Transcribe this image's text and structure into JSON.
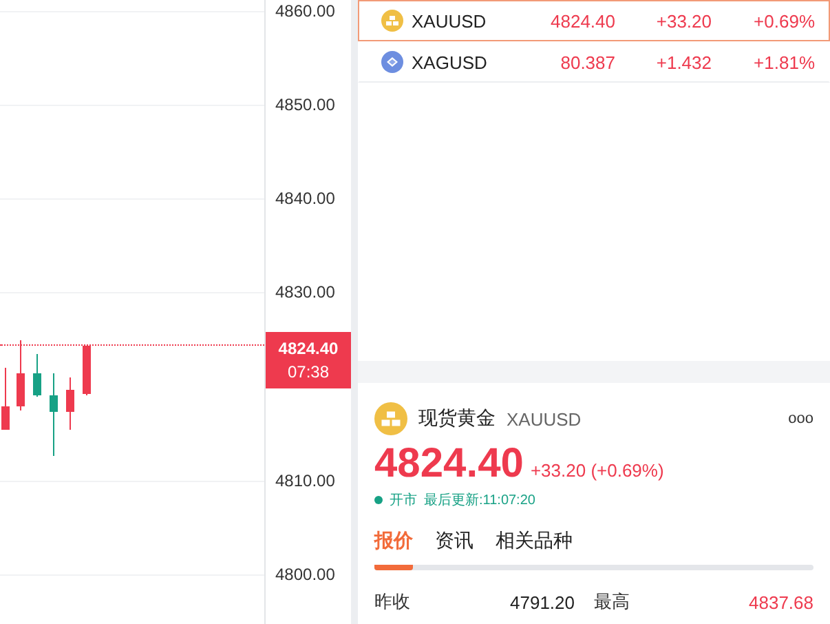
{
  "chart": {
    "y_ticks": [
      "4860.00",
      "4850.00",
      "4840.00",
      "4830.00",
      "4810.00",
      "4800.00"
    ],
    "price_label": "4824.40",
    "countdown": "07:38"
  },
  "watchlist": [
    {
      "kind": "bars",
      "symbol": "XAUUSD",
      "price": "4824.40",
      "change": "+33.20",
      "percent": "+0.69%",
      "selected": true
    },
    {
      "kind": "diamond",
      "symbol": "XAGUSD",
      "price": "80.387",
      "change": "+1.432",
      "percent": "+1.81%",
      "selected": false
    }
  ],
  "detail": {
    "name": "现货黄金",
    "symbol": "XAUUSD",
    "more": "ooo",
    "price": "4824.40",
    "change": "+33.20 (+0.69%)",
    "market_status": "开市",
    "updated": "最后更新:11:07:20",
    "tabs": [
      {
        "label": "报价",
        "selected": true
      },
      {
        "label": "资讯",
        "selected": false
      },
      {
        "label": "相关品种",
        "selected": false
      }
    ],
    "stats": [
      {
        "label": "昨收",
        "value": "4791.20",
        "kind": "plain"
      },
      {
        "label": "最高",
        "value": "4837.68",
        "kind": "rise"
      }
    ]
  }
}
